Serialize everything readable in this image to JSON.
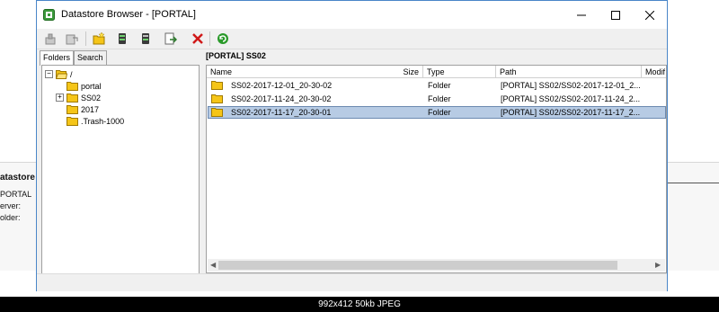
{
  "window": {
    "title": "Datastore Browser - [PORTAL]"
  },
  "background": {
    "panel_title": "atastore D",
    "line1": "PORTAL",
    "line2": "erver:",
    "line3": "older:"
  },
  "tabs": [
    {
      "label": "Folders"
    },
    {
      "label": "Search"
    }
  ],
  "tree": [
    {
      "label": "/"
    },
    {
      "label": "portal"
    },
    {
      "label": "SS02"
    },
    {
      "label": "2017"
    },
    {
      "label": ".Trash-1000"
    }
  ],
  "content": {
    "path_title": "[PORTAL] SS02",
    "columns": [
      "Name",
      "Size",
      "Type",
      "Path",
      "Modif"
    ],
    "rows": [
      {
        "name": "SS02-2017-12-01_20-30-02",
        "size": "",
        "type": "Folder",
        "path": "[PORTAL] SS02/SS02-2017-12-01_2..."
      },
      {
        "name": "SS02-2017-11-24_20-30-02",
        "size": "",
        "type": "Folder",
        "path": "[PORTAL] SS02/SS02-2017-11-24_2..."
      },
      {
        "name": "SS02-2017-11-17_20-30-01",
        "size": "",
        "type": "Folder",
        "path": "[PORTAL] SS02/SS02-2017-11-17_2..."
      }
    ],
    "selected_row": 2
  },
  "footer": {
    "caption": "992x412 50kb JPEG"
  },
  "icons": {
    "app": "datastore-app-icon",
    "toolbar": [
      "upload-icon",
      "download-icon",
      "new-folder-icon",
      "upload-file-icon",
      "download-file-icon",
      "move-icon",
      "delete-icon",
      "refresh-icon"
    ]
  },
  "colors": {
    "folder": "#f5c518",
    "selection": "#b7cbe4",
    "delete": "#d01818",
    "refresh": "#2a9a2a",
    "window_border": "#4a86c8"
  }
}
